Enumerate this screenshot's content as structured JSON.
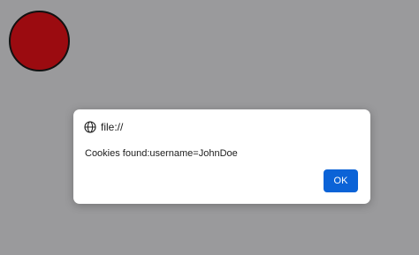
{
  "page": {
    "background_color": "#9a9a9c",
    "shape_color": "#9b0b10"
  },
  "dialog": {
    "origin_icon": "globe-icon",
    "origin": "file://",
    "message": "Cookies found:username=JohnDoe",
    "ok_label": "OK",
    "ok_color": "#0b63d7"
  }
}
